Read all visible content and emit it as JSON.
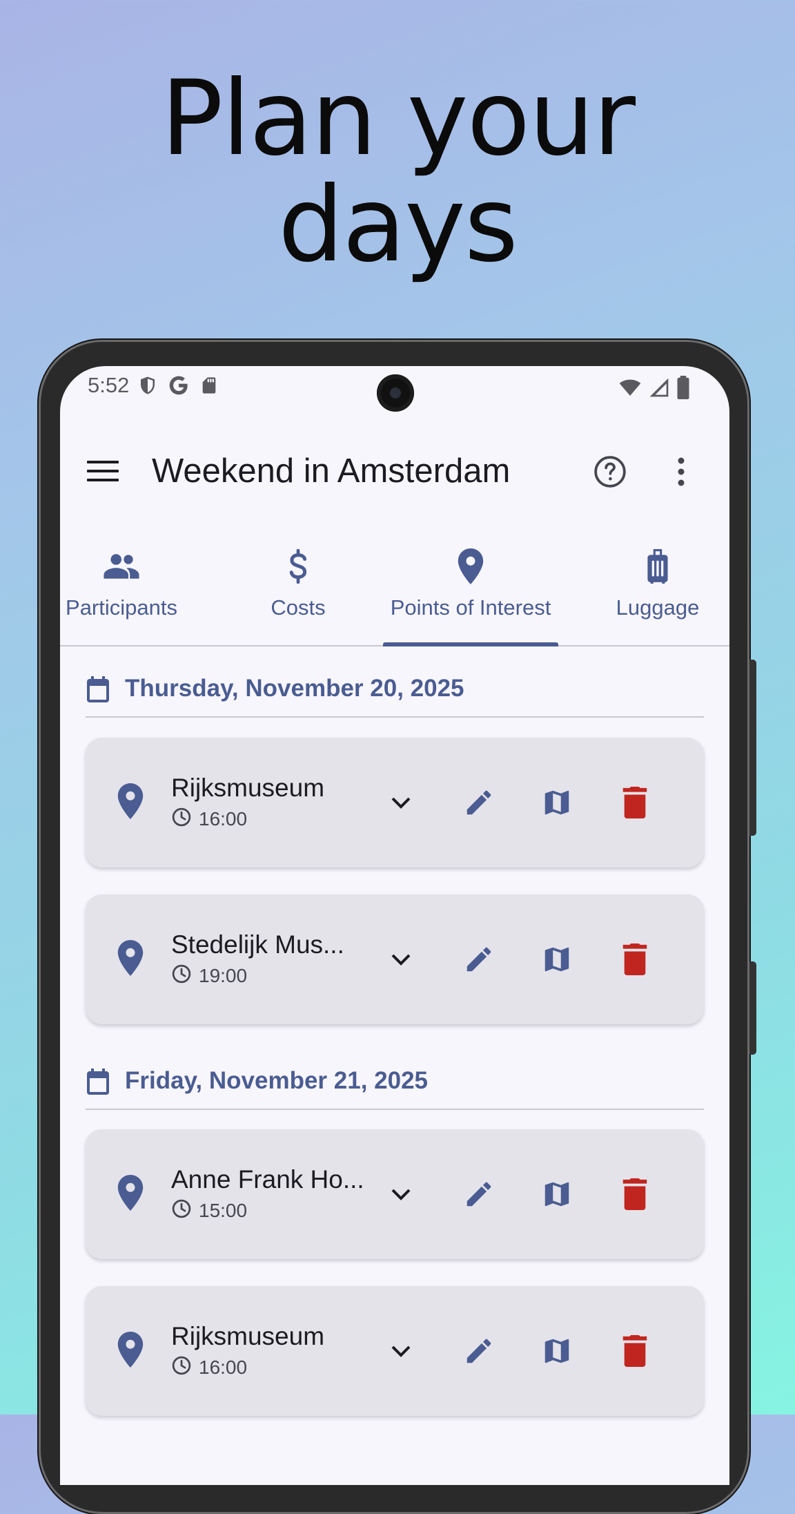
{
  "headline": {
    "line1": "Plan your",
    "line2": "days"
  },
  "status_bar": {
    "time": "5:52"
  },
  "app_bar": {
    "title": "Weekend in Amsterdam"
  },
  "tabs": [
    {
      "label": "Participants",
      "icon": "group-icon",
      "selected": false
    },
    {
      "label": "Costs",
      "icon": "dollar-icon",
      "selected": false
    },
    {
      "label": "Points of Interest",
      "icon": "location-pin-icon",
      "selected": true
    },
    {
      "label": "Luggage",
      "icon": "luggage-icon",
      "selected": false
    }
  ],
  "days": [
    {
      "title": "Thursday, November 20, 2025",
      "items": [
        {
          "name": "Rijksmuseum",
          "time": "16:00"
        },
        {
          "name": "Stedelijk Mus...",
          "time": "19:00"
        }
      ]
    },
    {
      "title": "Friday, November 21, 2025",
      "items": [
        {
          "name": "Anne Frank Ho...",
          "time": "15:00"
        },
        {
          "name": "Rijksmuseum",
          "time": "16:00"
        }
      ]
    }
  ],
  "colors": {
    "primary": "#4a5c91",
    "delete": "#c0261f",
    "card": "#e4e3ea",
    "surface": "#f7f6fd"
  }
}
